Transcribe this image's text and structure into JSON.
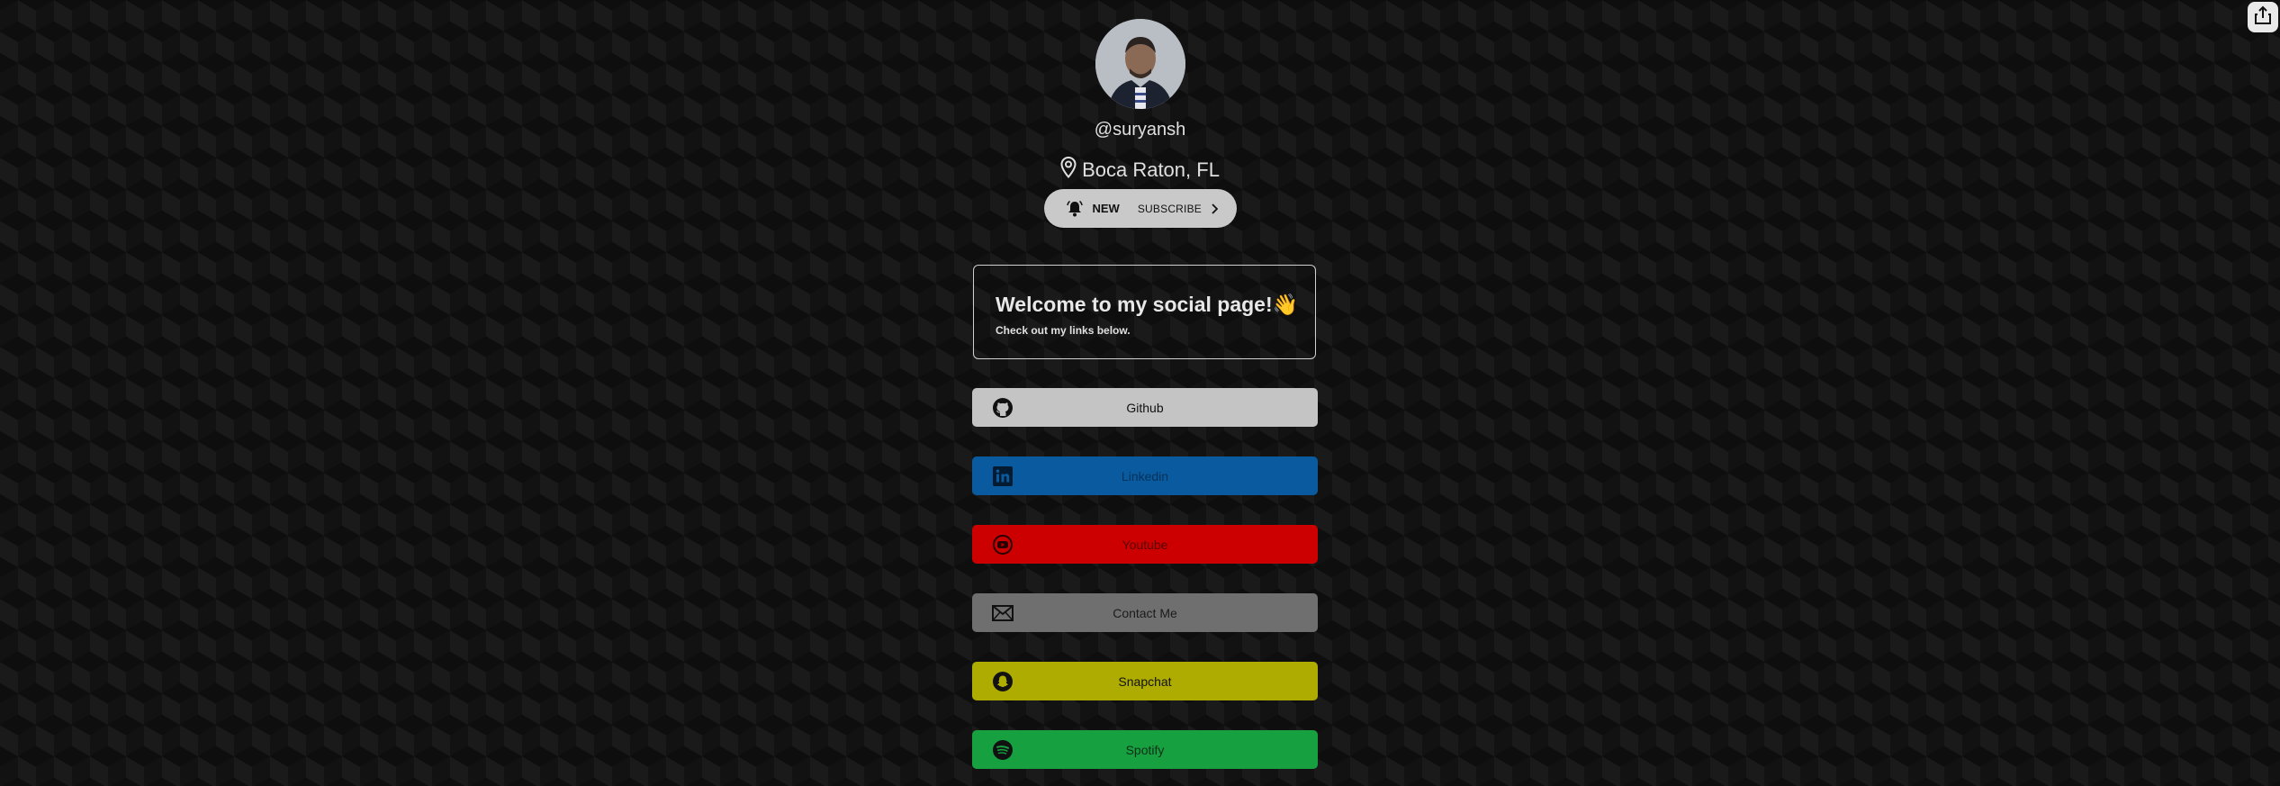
{
  "profile": {
    "handle": "@suryansh",
    "location": "Boca Raton, FL"
  },
  "subscribe": {
    "new_label": "NEW",
    "subscribe_label": "SUBSCRIBE"
  },
  "welcome": {
    "title": "Welcome to my social page!👋",
    "subtitle": "Check out my links below."
  },
  "links": [
    {
      "label": "Github",
      "icon": "github-icon",
      "color": "#c4c4c4"
    },
    {
      "label": "Linkedin",
      "icon": "linkedin-icon",
      "color": "#0a5aa0"
    },
    {
      "label": "Youtube",
      "icon": "youtube-icon",
      "color": "#cc0000"
    },
    {
      "label": "Contact Me",
      "icon": "mail-icon",
      "color": "#6f6f6f"
    },
    {
      "label": "Snapchat",
      "icon": "snapchat-icon",
      "color": "#aeac00"
    },
    {
      "label": "Spotify",
      "icon": "spotify-icon",
      "color": "#17a040"
    }
  ],
  "icons": {
    "share": "share-icon",
    "bell": "bell-icon",
    "location": "location-pin-icon",
    "chevron": "chevron-right-icon"
  }
}
